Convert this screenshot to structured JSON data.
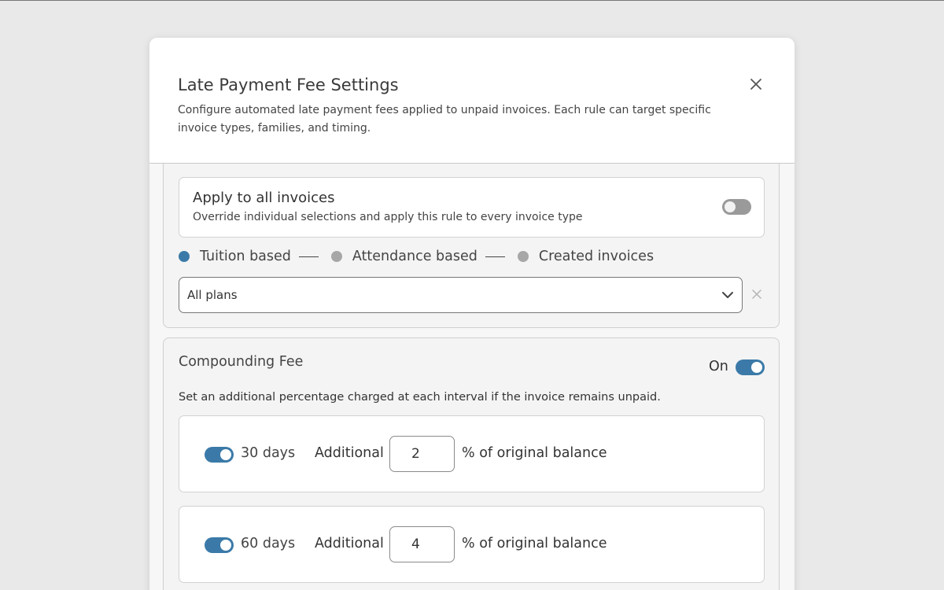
{
  "modal": {
    "title": "Late Payment Fee Settings",
    "description": "Configure automated late payment fees applied to unpaid invoices. Each rule can target specific invoice types, families, and timing."
  },
  "apply_all": {
    "title": "Apply to all invoices",
    "description": "Override individual selections and apply this rule to every invoice type",
    "enabled": false
  },
  "invoice_steps": [
    {
      "label": "Tuition based",
      "active": true
    },
    {
      "label": "Attendance based",
      "active": false
    },
    {
      "label": "Created invoices",
      "active": false
    }
  ],
  "plan_select": {
    "value": "All plans"
  },
  "compounding_fee": {
    "title": "Compounding Fee",
    "status_label": "On",
    "enabled": true,
    "description": "Set an additional percentage charged at each interval if the invoice remains unpaid.",
    "intervals": [
      {
        "days_label": "30 days",
        "additional_label": "Additional",
        "value": "2",
        "suffix": "% of original balance",
        "enabled": true
      },
      {
        "days_label": "60 days",
        "additional_label": "Additional",
        "value": "4",
        "suffix": "% of original balance",
        "enabled": true
      }
    ]
  },
  "colors": {
    "accent": "#3b7aa8",
    "inactive_dot": "#a7a7a7",
    "toggle_off": "#9a9a9a"
  }
}
